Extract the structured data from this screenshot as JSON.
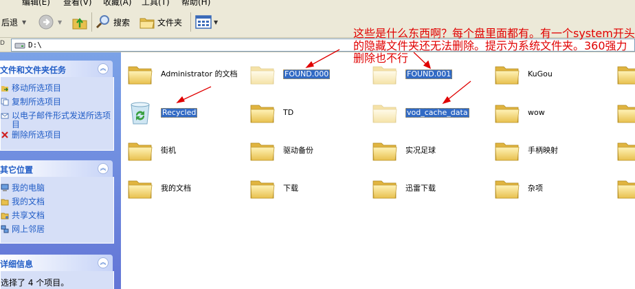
{
  "menu": {
    "items": [
      "编辑(E)",
      "查看(V)",
      "收藏(A)",
      "工具(T)",
      "帮助(H)"
    ]
  },
  "toolbar": {
    "back": "后退",
    "search": "搜索",
    "folders": "文件夹"
  },
  "address": {
    "label": "D",
    "path": "D:\\"
  },
  "left_pane": {
    "tasks": {
      "title": "文件和文件夹任务",
      "items": [
        "移动所选项目",
        "复制所选项目",
        "以电子邮件形式发送所选项目",
        "删除所选项目"
      ]
    },
    "other": {
      "title": "其它位置",
      "items": [
        "我的电脑",
        "我的文档",
        "共享文档",
        "网上邻居"
      ]
    },
    "details": {
      "title": "详细信息",
      "text": "选择了 4 个项目。"
    }
  },
  "files": [
    {
      "name": "Administrator 的文档",
      "selected": false,
      "kind": "folder"
    },
    {
      "name": "FOUND.000",
      "selected": true,
      "kind": "folder-hidden"
    },
    {
      "name": "FOUND.001",
      "selected": true,
      "kind": "folder-hidden"
    },
    {
      "name": "KuGou",
      "selected": false,
      "kind": "folder"
    },
    {
      "name": "Recycled",
      "selected": true,
      "kind": "recycle"
    },
    {
      "name": "TD",
      "selected": false,
      "kind": "folder"
    },
    {
      "name": "vod_cache_data",
      "selected": true,
      "kind": "folder-hidden"
    },
    {
      "name": "wow",
      "selected": false,
      "kind": "folder"
    },
    {
      "name": "街机",
      "selected": false,
      "kind": "folder"
    },
    {
      "name": "驱动备份",
      "selected": false,
      "kind": "folder"
    },
    {
      "name": "实况足球",
      "selected": false,
      "kind": "folder"
    },
    {
      "name": "手柄映射",
      "selected": false,
      "kind": "folder"
    },
    {
      "name": "我的文档",
      "selected": false,
      "kind": "folder"
    },
    {
      "name": "下载",
      "selected": false,
      "kind": "folder"
    },
    {
      "name": "迅雷下载",
      "selected": false,
      "kind": "folder"
    },
    {
      "name": "杂项",
      "selected": false,
      "kind": "folder"
    }
  ],
  "annotation": {
    "text": "这些是什么东西啊？每个盘里面都有。有一个system开头的隐藏文件夹还无法删除。提示为系统文件夹。360强力删除也不行"
  },
  "colors": {
    "accent": "#316ac5",
    "annotation": "#e00000",
    "panel_link": "#215dc6",
    "folder": "#f4d77a"
  }
}
